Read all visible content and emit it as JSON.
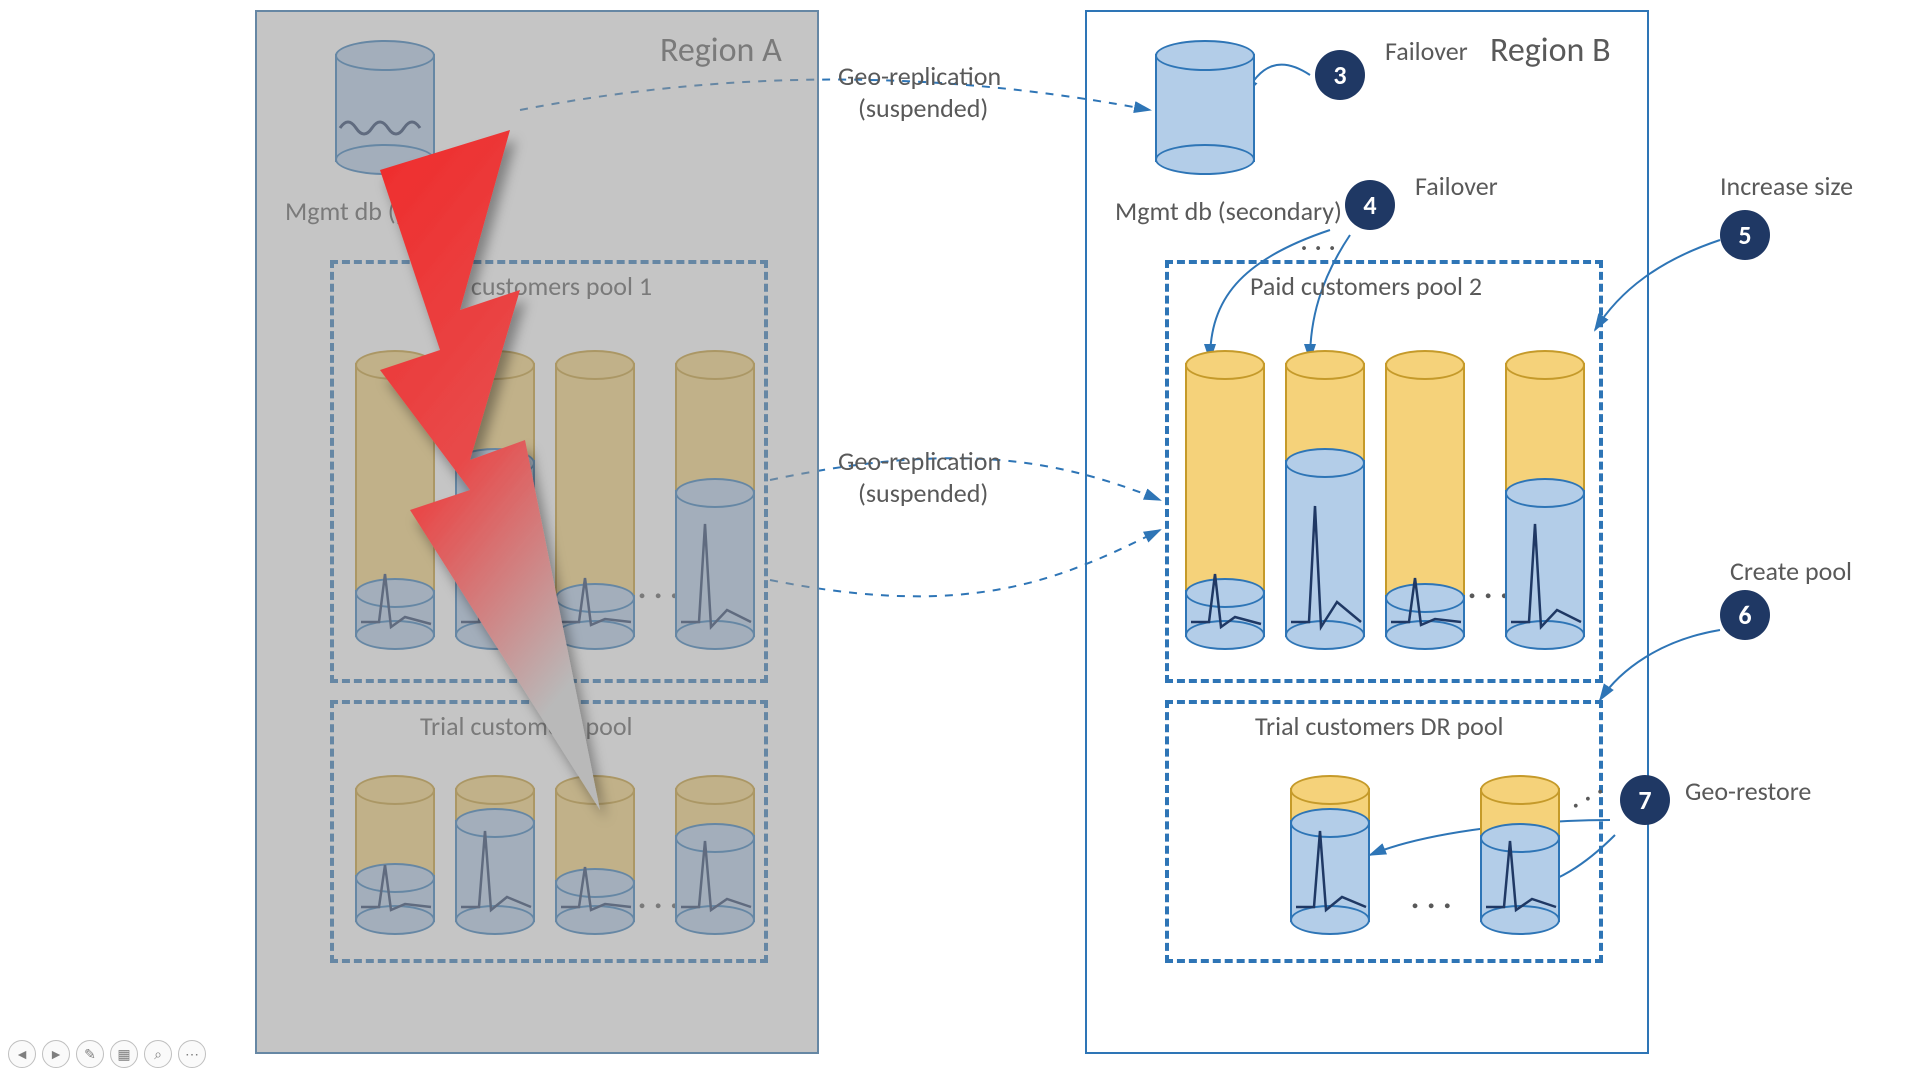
{
  "regionA": {
    "title": "Region A",
    "mgmt_label": "Mgmt db (primary)",
    "pool1_title": "Paid customers pool 1",
    "pool2_title": "Trial customers pool"
  },
  "regionB": {
    "title": "Region B",
    "mgmt_label": "Mgmt db (secondary)",
    "pool1_title": "Paid customers pool 2",
    "pool2_title": "Trial customers DR pool"
  },
  "labels": {
    "geo1": "Geo-replication",
    "geo1b": "(suspended)",
    "geo2": "Geo-replication",
    "geo2b": "(suspended)",
    "s3": "Failover",
    "s4": "Failover",
    "s5": "Increase size",
    "s6": "Create pool",
    "s7": "Geo-restore"
  },
  "steps": {
    "n3": "3",
    "n4": "4",
    "n5": "5",
    "n6": "6",
    "n7": "7"
  },
  "ellipsis": "..."
}
